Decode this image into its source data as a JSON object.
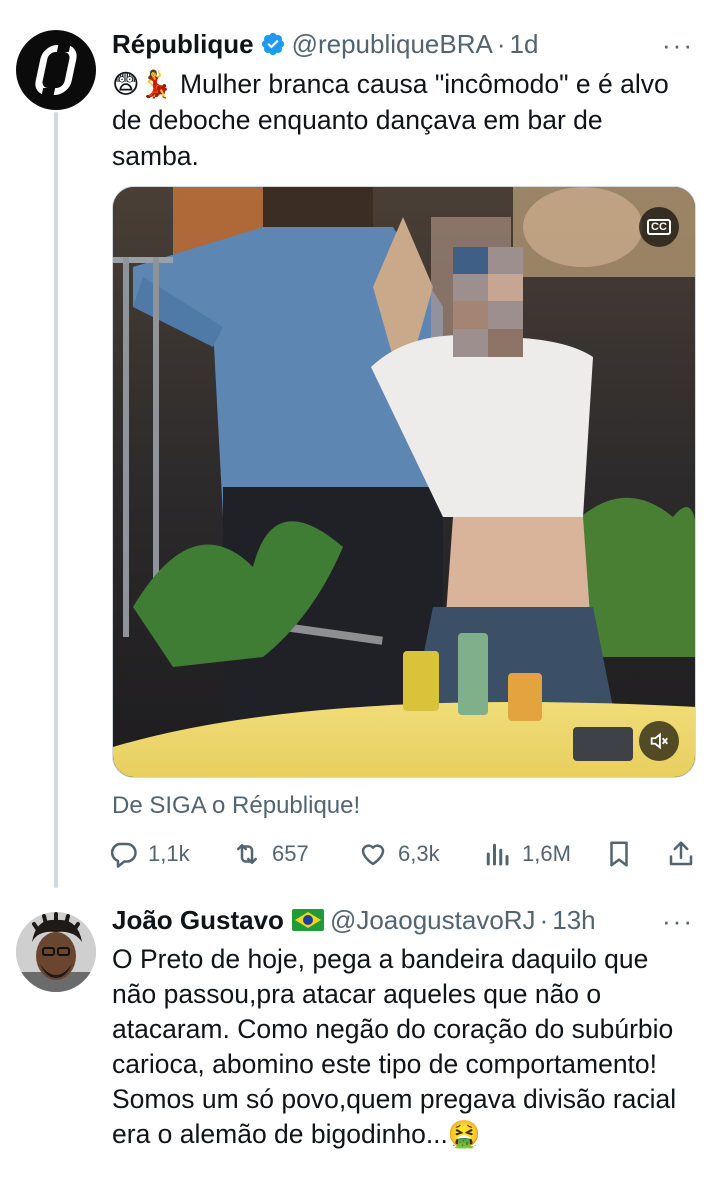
{
  "tweet1": {
    "author_name": "République",
    "author_handle": "@republiqueBRA",
    "separator": "·",
    "time": "1d",
    "more_label": "···",
    "text": "😨💃 Mulher branca causa \"incômodo\" e é alvo de deboche enquanto dançava em bar de samba.",
    "media": {
      "type": "video",
      "cc_label": "CC"
    },
    "promo_text": "De SIGA o République!",
    "actions": {
      "replies": "1,1k",
      "reposts": "657",
      "likes": "6,3k",
      "views": "1,6M"
    }
  },
  "tweet2": {
    "author_name": "João Gustavo",
    "author_handle": "@JoaogustavoRJ",
    "separator": "·",
    "time": "13h",
    "more_label": "···",
    "text": "O Preto de hoje, pega a bandeira daquilo que não passou,pra atacar aqueles que não o atacaram. Como negão do coração do subúrbio carioca, abomino este tipo de comportamento!\nSomos um só povo,quem pregava divisão racial era o alemão de bigodinho...🤮"
  },
  "colors": {
    "text_primary": "#0f1419",
    "text_secondary": "#536471",
    "verified_blue": "#1d9bf0",
    "thread_line": "#cfd9de"
  },
  "icons": [
    "reply-icon",
    "repost-icon",
    "like-icon",
    "views-icon",
    "bookmark-icon",
    "share-icon",
    "verified-icon",
    "brazil-flag-icon",
    "cc-icon",
    "mute-icon"
  ]
}
